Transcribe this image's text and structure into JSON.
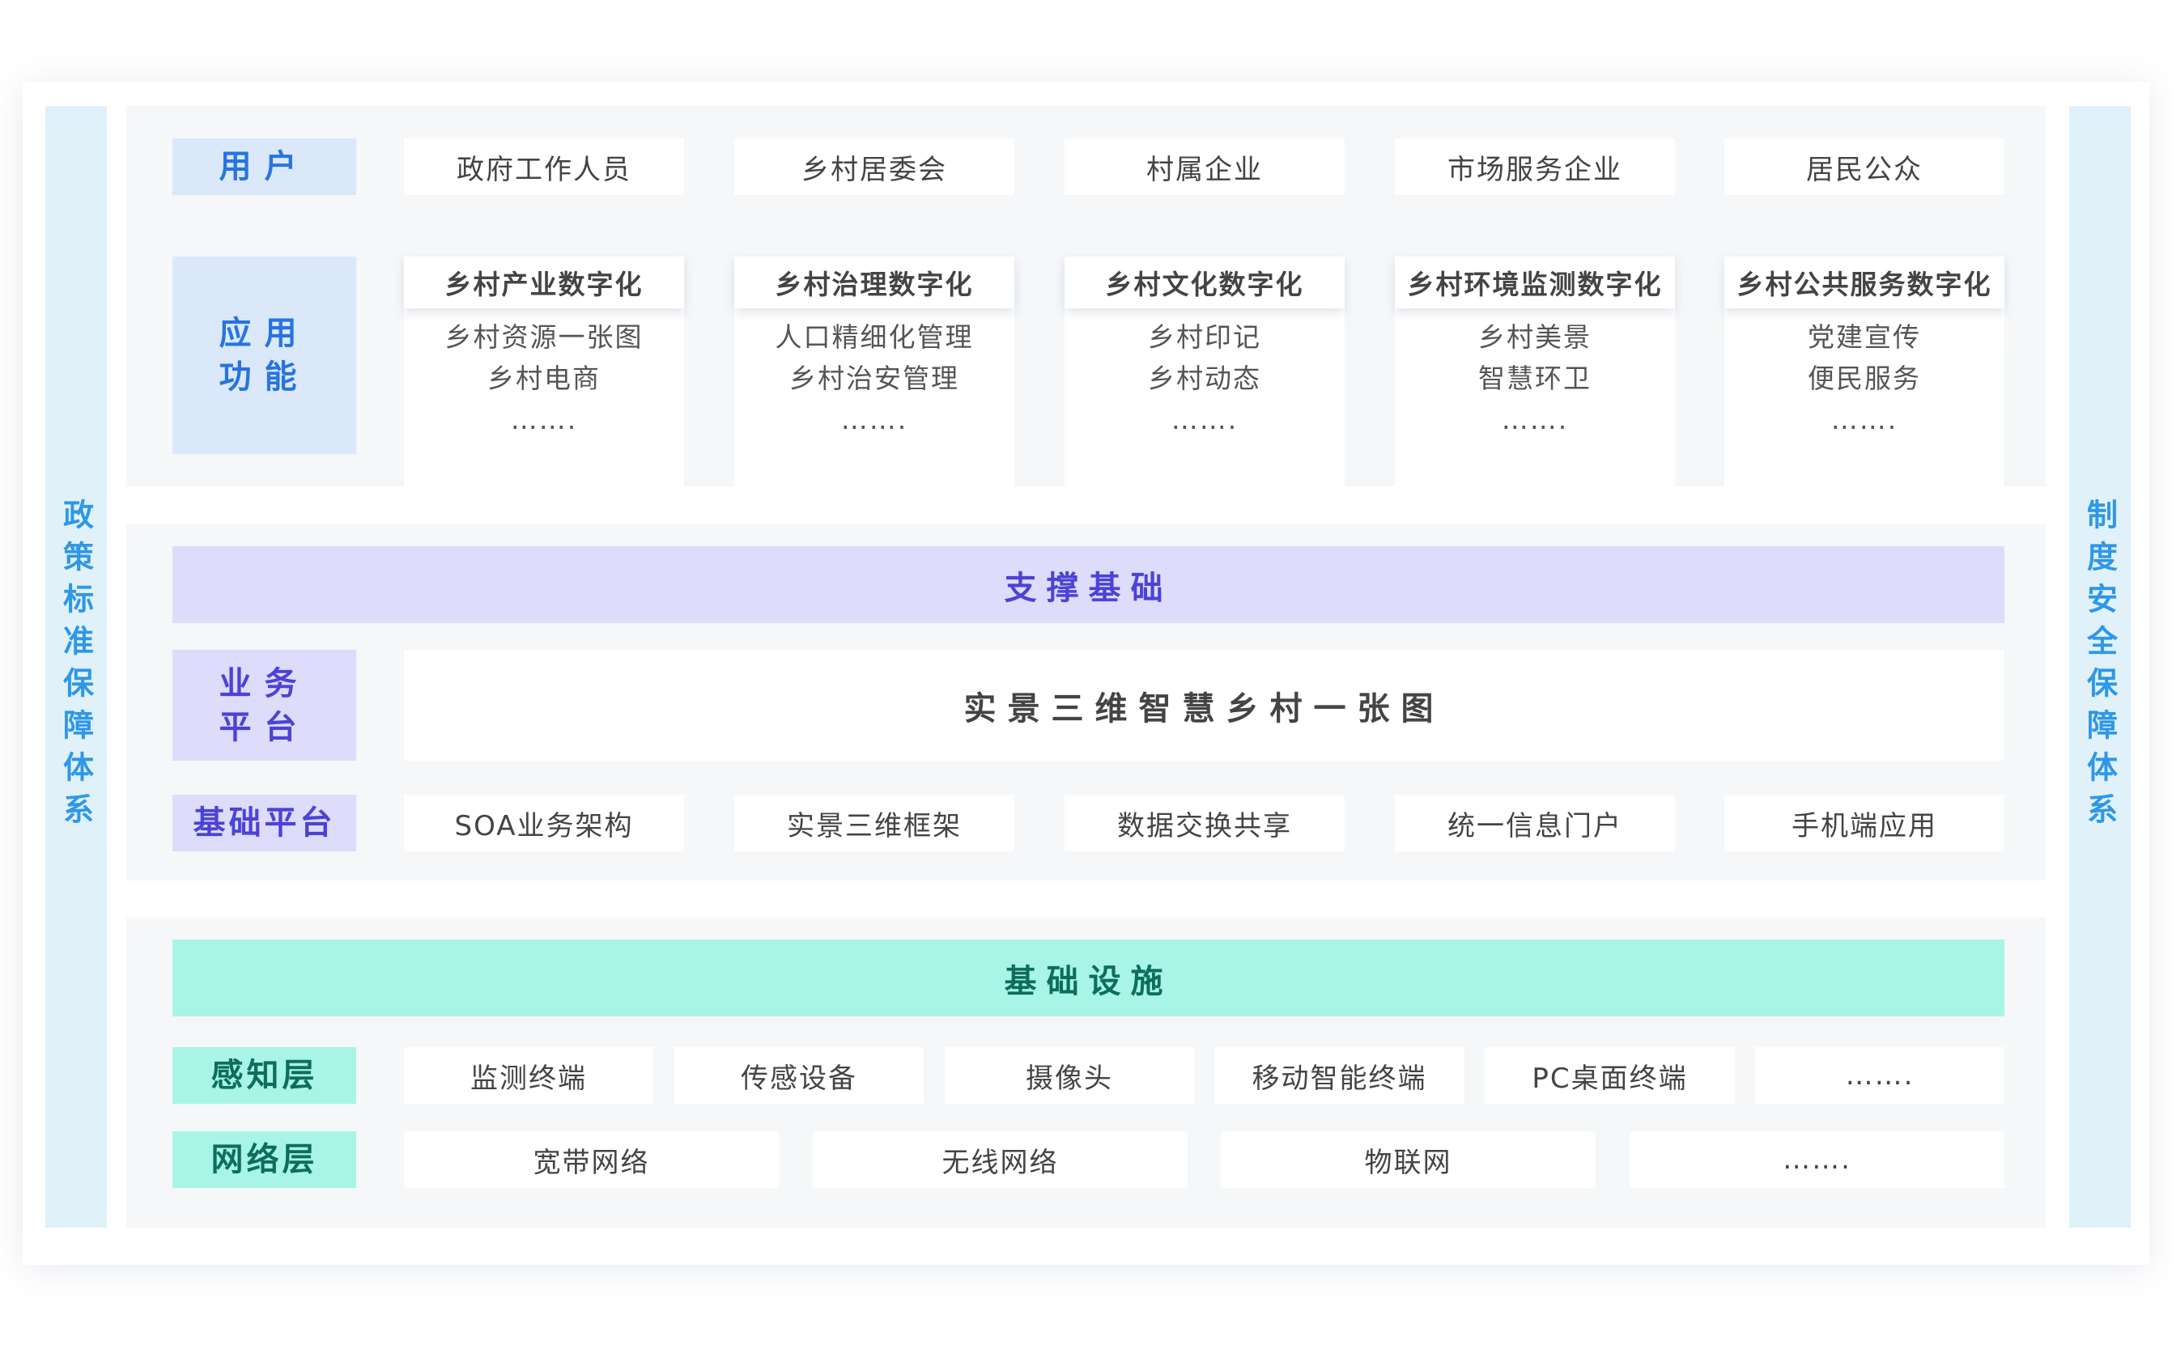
{
  "left_pillar": "政策标准保障体系",
  "right_pillar": "制度安全保障体系",
  "users": {
    "label": "用户",
    "items": [
      "政府工作人员",
      "乡村居委会",
      "村属企业",
      "市场服务企业",
      "居民公众"
    ]
  },
  "functions": {
    "label": "应用\n功能",
    "cards": [
      {
        "title": "乡村产业数字化",
        "items": [
          "乡村资源一张图",
          "乡村电商",
          "……."
        ]
      },
      {
        "title": "乡村治理数字化",
        "items": [
          "人口精细化管理",
          "乡村治安管理",
          "……."
        ]
      },
      {
        "title": "乡村文化数字化",
        "items": [
          "乡村印记",
          "乡村动态",
          "……."
        ]
      },
      {
        "title": "乡村环境监测数字化",
        "items": [
          "乡村美景",
          "智慧环卫",
          "……."
        ]
      },
      {
        "title": "乡村公共服务数字化",
        "items": [
          "党建宣传",
          "便民服务",
          "……."
        ]
      }
    ]
  },
  "support": {
    "title": "支撑基础",
    "business": {
      "label": "业务\n平台",
      "content": "实景三维智慧乡村一张图"
    },
    "base": {
      "label": "基础平台",
      "items": [
        "SOA业务架构",
        "实景三维框架",
        "数据交换共享",
        "统一信息门户",
        "手机端应用"
      ]
    }
  },
  "infrastructure": {
    "title": "基础设施",
    "perception": {
      "label": "感知层",
      "items": [
        "监测终端",
        "传感设备",
        "摄像头",
        "移动智能终端",
        "PC桌面终端",
        "……."
      ]
    },
    "network": {
      "label": "网络层",
      "items": [
        "宽带网络",
        "无线网络",
        "物联网",
        "……."
      ]
    }
  }
}
